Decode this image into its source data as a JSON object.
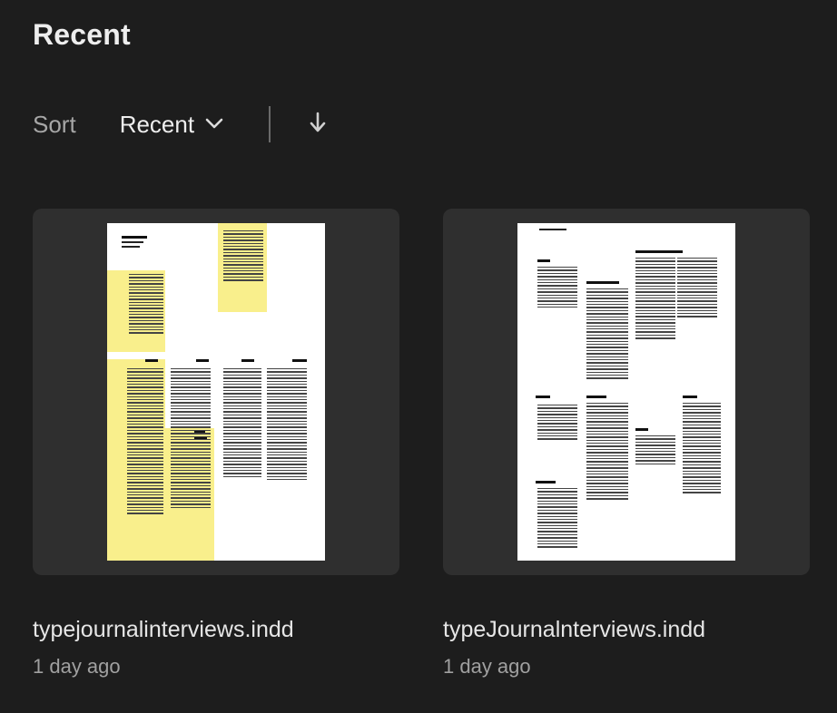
{
  "header": {
    "title": "Recent"
  },
  "sort": {
    "label": "Sort",
    "selected": "Recent",
    "chevron_icon": "chevron-down-icon",
    "direction_icon": "arrow-down-icon"
  },
  "files": [
    {
      "name": "typejournalinterviews.indd",
      "modified": "1 day ago"
    },
    {
      "name": "typeJournalnterviews.indd",
      "modified": "1 day ago"
    }
  ],
  "colors": {
    "background": "#1d1d1d",
    "card": "#2f2f2f",
    "highlight": "#f9ef8c"
  }
}
